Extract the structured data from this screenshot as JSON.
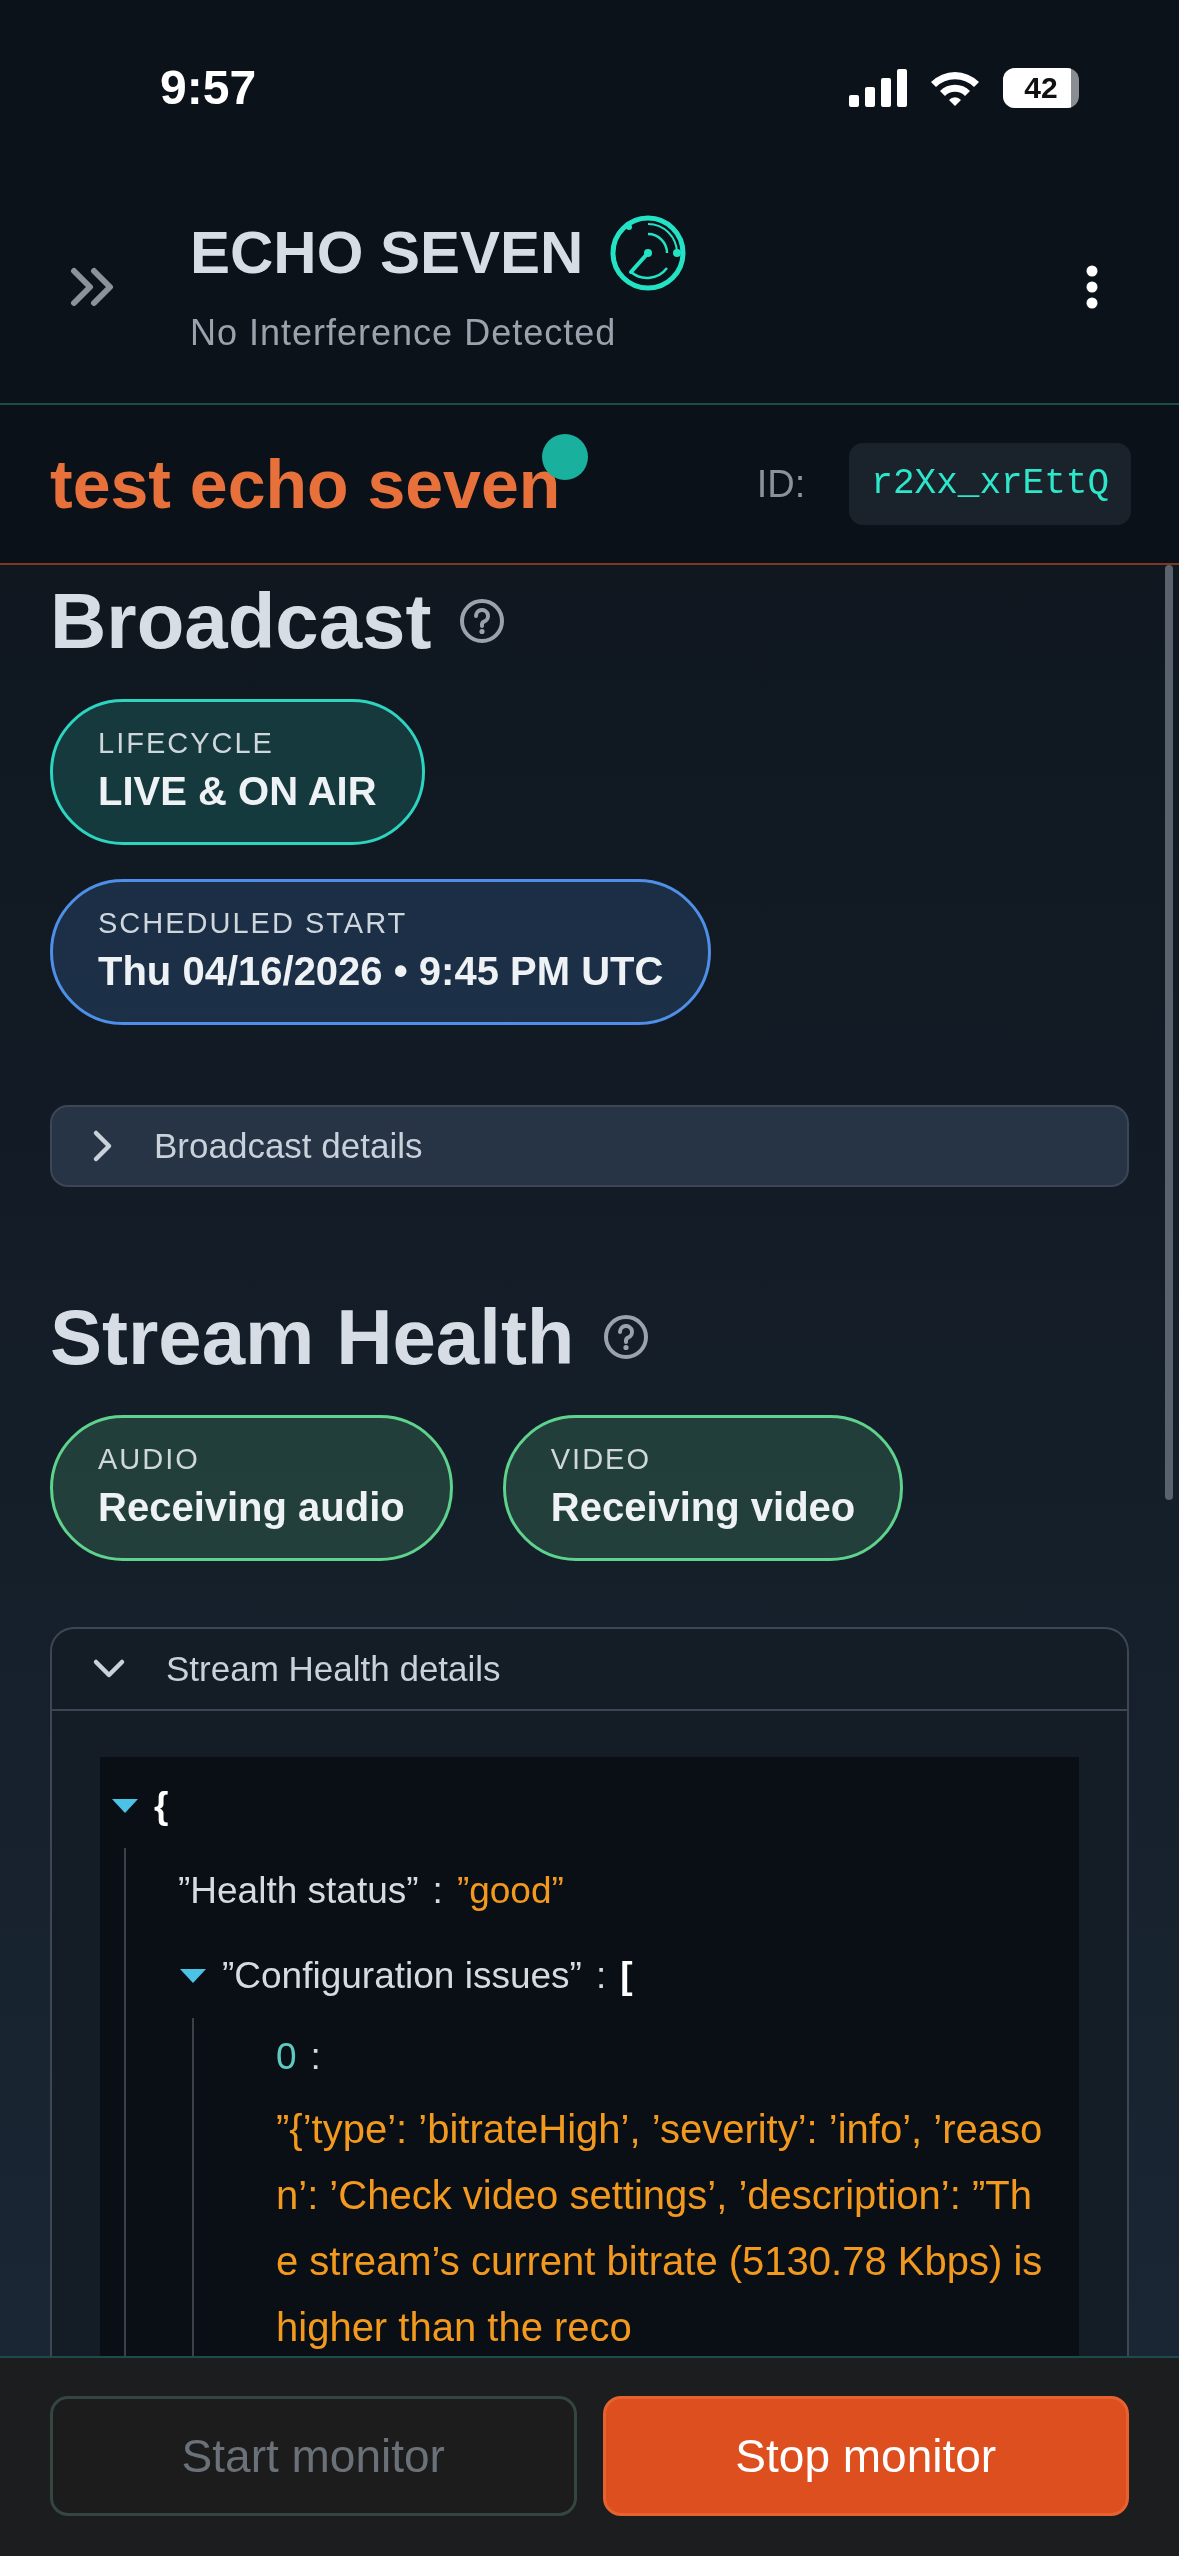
{
  "status_bar": {
    "time": "9:57",
    "battery": "42"
  },
  "header": {
    "title": "ECHO SEVEN",
    "subtitle": "No Interference Detected"
  },
  "stream": {
    "name": "test echo seven",
    "live": true,
    "id_label": "ID:",
    "id": "r2Xx_xrEttQ"
  },
  "sections": [
    {
      "title": "Broadcast",
      "badges": [
        {
          "label": "LIFECYCLE",
          "value": "LIVE & ON AIR",
          "color": "#2dd4bf"
        },
        {
          "label": "SCHEDULED START",
          "value": "Thu 04/16/2026 • 9:45 PM UTC",
          "color": "#4f8fe8"
        }
      ],
      "details": {
        "label": "Broadcast details",
        "expanded": false
      }
    },
    {
      "title": "Stream Health",
      "badges": [
        {
          "label": "AUDIO",
          "value": "Receiving audio",
          "color": "#5fd38d"
        },
        {
          "label": "VIDEO",
          "value": "Receiving video",
          "color": "#5fd38d"
        }
      ],
      "details": {
        "label": "Stream Health details",
        "expanded": true,
        "tree": {
          "kind": "object",
          "bracket": "{",
          "expanded": true,
          "children": [
            {
              "kind": "pair",
              "key": "”Health status”",
              "sep": ":",
              "value": "”good”"
            },
            {
              "kind": "array",
              "key": "”Configuration issues”",
              "sep": ":",
              "bracket": "[",
              "expanded": true,
              "children": [
                {
                  "kind": "item",
                  "index": "0",
                  "sep": ":",
                  "value": "”{’type’: ’bitrateHigh’, ’severity’: ’info’, ’reason’: ’Check video settings’, ’description’: ”The stream’s current bitrate (5130.78 Kbps) is higher than the reco"
                }
              ]
            }
          ]
        }
      }
    }
  ],
  "buttons": [
    {
      "label": "Start monitor",
      "kind": "secondary",
      "disabled": true
    },
    {
      "label": "Stop monitor",
      "kind": "primary",
      "disabled": false
    }
  ]
}
